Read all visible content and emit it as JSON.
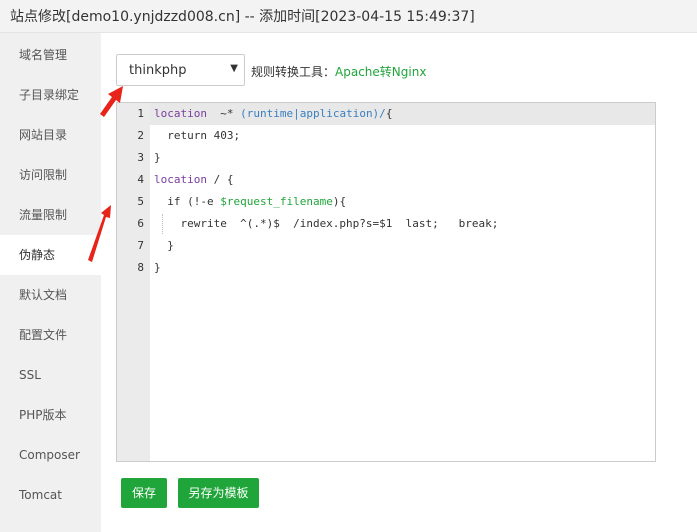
{
  "title": "站点修改[demo10.ynjdzzd008.cn] -- 添加时间[2023-04-15 15:49:37]",
  "sidebar": {
    "items": [
      {
        "label": "域名管理"
      },
      {
        "label": "子目录绑定"
      },
      {
        "label": "网站目录"
      },
      {
        "label": "访问限制"
      },
      {
        "label": "流量限制"
      },
      {
        "label": "伪静态"
      },
      {
        "label": "默认文档"
      },
      {
        "label": "配置文件"
      },
      {
        "label": "SSL"
      },
      {
        "label": "PHP版本"
      },
      {
        "label": "Composer"
      },
      {
        "label": "Tomcat"
      }
    ],
    "active": "伪静态"
  },
  "rewrite": {
    "selected_template": "thinkphp",
    "tool_label": "规则转换工具：",
    "tool_link": "Apache转Nginx"
  },
  "editor": {
    "line_numbers": [
      "1",
      "2",
      "3",
      "4",
      "5",
      "6",
      "7",
      "8"
    ],
    "lines": [
      {
        "parts": [
          [
            "kw",
            "location"
          ],
          [
            "",
            "  ~* "
          ],
          [
            "re",
            "(runtime|application)/"
          ],
          [
            "",
            "{"
          ]
        ]
      },
      {
        "parts": [
          [
            "",
            "  return 403;"
          ]
        ]
      },
      {
        "parts": [
          [
            "",
            "}"
          ]
        ]
      },
      {
        "parts": [
          [
            "kw",
            "location"
          ],
          [
            "",
            " / {"
          ]
        ]
      },
      {
        "parts": [
          [
            "",
            "  if (!-e "
          ],
          [
            "var",
            "$request_filename"
          ],
          [
            "",
            "){"
          ]
        ]
      },
      {
        "parts": [
          [
            "",
            "    rewrite  ^(.*)$  /index.php?s=$1  last;   break;"
          ]
        ]
      },
      {
        "parts": [
          [
            "",
            "  }"
          ]
        ]
      },
      {
        "parts": [
          [
            "",
            "}"
          ]
        ]
      }
    ]
  },
  "buttons": {
    "save": "保存",
    "save_as_template": "另存为模板"
  },
  "colors": {
    "accent": "#20a53a",
    "annotation_arrow": "#e8231a"
  }
}
